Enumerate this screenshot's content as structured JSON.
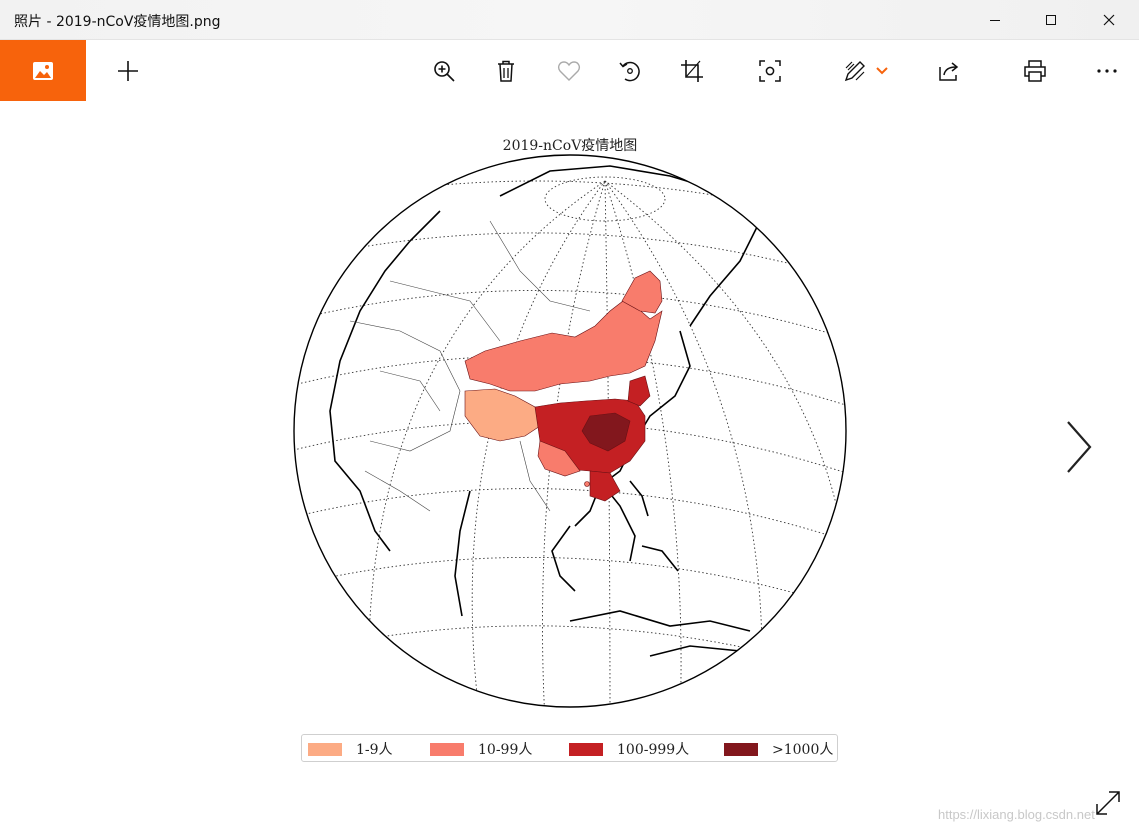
{
  "window": {
    "title": "照片 - 2019-nCoV疫情地图.png",
    "minimize_icon": "minimize-icon",
    "maximize_icon": "maximize-icon",
    "close_icon": "close-icon"
  },
  "toolbar": {
    "app_icon": "photos-app-icon",
    "add_icon": "plus-icon",
    "buttons": [
      "zoom-in-icon",
      "delete-icon",
      "favorite-heart-icon",
      "rotate-icon",
      "crop-icon",
      "enhance-icon",
      "edit-draw-icon",
      "share-icon",
      "print-icon",
      "more-icon"
    ],
    "accent_color": "#f7630c"
  },
  "image": {
    "title": "2019-nCoV疫情地图",
    "legend": [
      {
        "label": "1-9人",
        "color": "#fcab84"
      },
      {
        "label": "10-99人",
        "color": "#f87c6c"
      },
      {
        "label": "100-999人",
        "color": "#c42023"
      },
      {
        "label": ">1000人",
        "color": "#82171d"
      }
    ]
  },
  "viewer": {
    "next_icon": "chevron-right-icon",
    "fullscreen_icon": "expand-icon",
    "watermark": "https://lixiang.blog.csdn.net"
  }
}
